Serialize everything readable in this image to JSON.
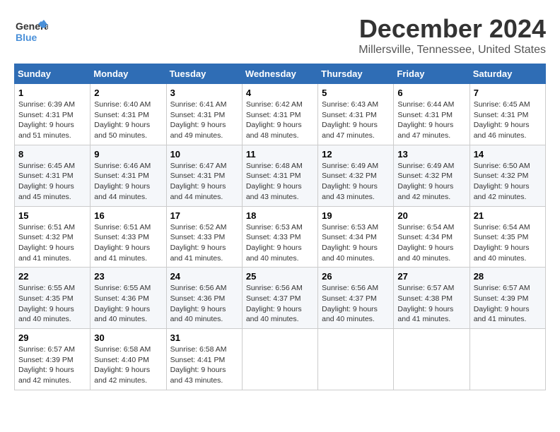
{
  "logo": {
    "line1": "General",
    "line2": "Blue"
  },
  "title": "December 2024",
  "subtitle": "Millersville, Tennessee, United States",
  "days_header": [
    "Sunday",
    "Monday",
    "Tuesday",
    "Wednesday",
    "Thursday",
    "Friday",
    "Saturday"
  ],
  "weeks": [
    [
      {
        "day": "1",
        "sunrise": "Sunrise: 6:39 AM",
        "sunset": "Sunset: 4:31 PM",
        "daylight": "Daylight: 9 hours and 51 minutes."
      },
      {
        "day": "2",
        "sunrise": "Sunrise: 6:40 AM",
        "sunset": "Sunset: 4:31 PM",
        "daylight": "Daylight: 9 hours and 50 minutes."
      },
      {
        "day": "3",
        "sunrise": "Sunrise: 6:41 AM",
        "sunset": "Sunset: 4:31 PM",
        "daylight": "Daylight: 9 hours and 49 minutes."
      },
      {
        "day": "4",
        "sunrise": "Sunrise: 6:42 AM",
        "sunset": "Sunset: 4:31 PM",
        "daylight": "Daylight: 9 hours and 48 minutes."
      },
      {
        "day": "5",
        "sunrise": "Sunrise: 6:43 AM",
        "sunset": "Sunset: 4:31 PM",
        "daylight": "Daylight: 9 hours and 47 minutes."
      },
      {
        "day": "6",
        "sunrise": "Sunrise: 6:44 AM",
        "sunset": "Sunset: 4:31 PM",
        "daylight": "Daylight: 9 hours and 47 minutes."
      },
      {
        "day": "7",
        "sunrise": "Sunrise: 6:45 AM",
        "sunset": "Sunset: 4:31 PM",
        "daylight": "Daylight: 9 hours and 46 minutes."
      }
    ],
    [
      {
        "day": "8",
        "sunrise": "Sunrise: 6:45 AM",
        "sunset": "Sunset: 4:31 PM",
        "daylight": "Daylight: 9 hours and 45 minutes."
      },
      {
        "day": "9",
        "sunrise": "Sunrise: 6:46 AM",
        "sunset": "Sunset: 4:31 PM",
        "daylight": "Daylight: 9 hours and 44 minutes."
      },
      {
        "day": "10",
        "sunrise": "Sunrise: 6:47 AM",
        "sunset": "Sunset: 4:31 PM",
        "daylight": "Daylight: 9 hours and 44 minutes."
      },
      {
        "day": "11",
        "sunrise": "Sunrise: 6:48 AM",
        "sunset": "Sunset: 4:31 PM",
        "daylight": "Daylight: 9 hours and 43 minutes."
      },
      {
        "day": "12",
        "sunrise": "Sunrise: 6:49 AM",
        "sunset": "Sunset: 4:32 PM",
        "daylight": "Daylight: 9 hours and 43 minutes."
      },
      {
        "day": "13",
        "sunrise": "Sunrise: 6:49 AM",
        "sunset": "Sunset: 4:32 PM",
        "daylight": "Daylight: 9 hours and 42 minutes."
      },
      {
        "day": "14",
        "sunrise": "Sunrise: 6:50 AM",
        "sunset": "Sunset: 4:32 PM",
        "daylight": "Daylight: 9 hours and 42 minutes."
      }
    ],
    [
      {
        "day": "15",
        "sunrise": "Sunrise: 6:51 AM",
        "sunset": "Sunset: 4:32 PM",
        "daylight": "Daylight: 9 hours and 41 minutes."
      },
      {
        "day": "16",
        "sunrise": "Sunrise: 6:51 AM",
        "sunset": "Sunset: 4:33 PM",
        "daylight": "Daylight: 9 hours and 41 minutes."
      },
      {
        "day": "17",
        "sunrise": "Sunrise: 6:52 AM",
        "sunset": "Sunset: 4:33 PM",
        "daylight": "Daylight: 9 hours and 41 minutes."
      },
      {
        "day": "18",
        "sunrise": "Sunrise: 6:53 AM",
        "sunset": "Sunset: 4:33 PM",
        "daylight": "Daylight: 9 hours and 40 minutes."
      },
      {
        "day": "19",
        "sunrise": "Sunrise: 6:53 AM",
        "sunset": "Sunset: 4:34 PM",
        "daylight": "Daylight: 9 hours and 40 minutes."
      },
      {
        "day": "20",
        "sunrise": "Sunrise: 6:54 AM",
        "sunset": "Sunset: 4:34 PM",
        "daylight": "Daylight: 9 hours and 40 minutes."
      },
      {
        "day": "21",
        "sunrise": "Sunrise: 6:54 AM",
        "sunset": "Sunset: 4:35 PM",
        "daylight": "Daylight: 9 hours and 40 minutes."
      }
    ],
    [
      {
        "day": "22",
        "sunrise": "Sunrise: 6:55 AM",
        "sunset": "Sunset: 4:35 PM",
        "daylight": "Daylight: 9 hours and 40 minutes."
      },
      {
        "day": "23",
        "sunrise": "Sunrise: 6:55 AM",
        "sunset": "Sunset: 4:36 PM",
        "daylight": "Daylight: 9 hours and 40 minutes."
      },
      {
        "day": "24",
        "sunrise": "Sunrise: 6:56 AM",
        "sunset": "Sunset: 4:36 PM",
        "daylight": "Daylight: 9 hours and 40 minutes."
      },
      {
        "day": "25",
        "sunrise": "Sunrise: 6:56 AM",
        "sunset": "Sunset: 4:37 PM",
        "daylight": "Daylight: 9 hours and 40 minutes."
      },
      {
        "day": "26",
        "sunrise": "Sunrise: 6:56 AM",
        "sunset": "Sunset: 4:37 PM",
        "daylight": "Daylight: 9 hours and 40 minutes."
      },
      {
        "day": "27",
        "sunrise": "Sunrise: 6:57 AM",
        "sunset": "Sunset: 4:38 PM",
        "daylight": "Daylight: 9 hours and 41 minutes."
      },
      {
        "day": "28",
        "sunrise": "Sunrise: 6:57 AM",
        "sunset": "Sunset: 4:39 PM",
        "daylight": "Daylight: 9 hours and 41 minutes."
      }
    ],
    [
      {
        "day": "29",
        "sunrise": "Sunrise: 6:57 AM",
        "sunset": "Sunset: 4:39 PM",
        "daylight": "Daylight: 9 hours and 42 minutes."
      },
      {
        "day": "30",
        "sunrise": "Sunrise: 6:58 AM",
        "sunset": "Sunset: 4:40 PM",
        "daylight": "Daylight: 9 hours and 42 minutes."
      },
      {
        "day": "31",
        "sunrise": "Sunrise: 6:58 AM",
        "sunset": "Sunset: 4:41 PM",
        "daylight": "Daylight: 9 hours and 43 minutes."
      },
      null,
      null,
      null,
      null
    ]
  ]
}
